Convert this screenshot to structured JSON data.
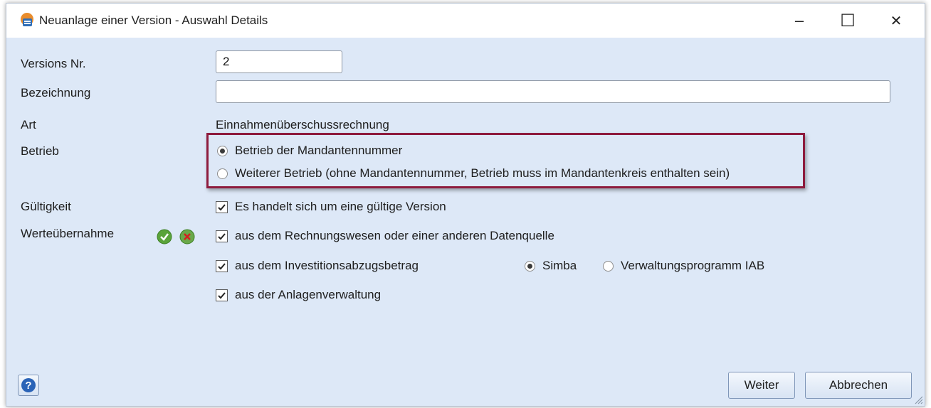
{
  "window": {
    "title": "Neuanlage einer Version - Auswahl Details",
    "minimize": "–",
    "maximize": "☐",
    "close": "✕"
  },
  "form": {
    "version_label": "Versions Nr.",
    "version_value": "2",
    "bezeichnung_label": "Bezeichnung",
    "bezeichnung_value": "",
    "art_label": "Art",
    "art_value": "Einnahmenüberschussrechnung",
    "betrieb_label": "Betrieb",
    "betrieb_options": [
      {
        "label": "Betrieb der Mandantennummer",
        "selected": true
      },
      {
        "label": "Weiterer Betrieb (ohne Mandantennummer, Betrieb muss im Mandantenkreis enthalten sein)",
        "selected": false
      }
    ],
    "gueltigkeit_label": "Gültigkeit",
    "gueltigkeit_check": "Es handelt sich um eine gültige Version",
    "werteuebernahme_label": "Werteübernahme",
    "werte_checks": [
      "aus dem Rechnungswesen oder einer anderen Datenquelle",
      "aus dem Investitionsabzugsbetrag",
      "aus der Anlagenverwaltung"
    ],
    "iab_options": [
      {
        "label": "Simba",
        "selected": true
      },
      {
        "label": "Verwaltungsprogramm IAB",
        "selected": false
      }
    ]
  },
  "buttons": {
    "weiter": "Weiter",
    "abbrechen": "Abbrechen"
  },
  "colors": {
    "highlight": "#8e1b3d",
    "dialog_bg": "#dde8f7"
  }
}
